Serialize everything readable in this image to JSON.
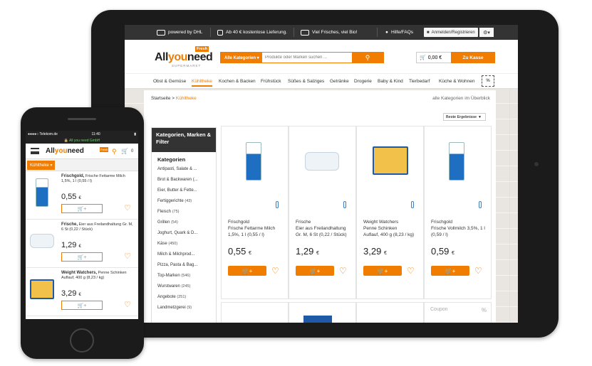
{
  "colors": {
    "accent": "#f07d00",
    "topbar": "#333333"
  },
  "tablet": {
    "topbar": {
      "dhl": "powered by DHL",
      "delivery": "Ab 40 € kostenlose Lieferung.",
      "bio": "Viel Frisches, viel Bio!",
      "help": "Hilfe/FAQs",
      "login": "Anmelden/Registrieren"
    },
    "logo": {
      "part1": "All",
      "part2": "you",
      "part3": "need",
      "fresh": "Fresh",
      "sub": "SUPERMARKT"
    },
    "search": {
      "category": "Alle Kategorien ▾",
      "placeholder": "Produkte oder Marken suchen ..."
    },
    "cart": {
      "total": "0,00 €",
      "checkout": "Zu Kasse"
    },
    "nav": [
      "Obst & Gemüse",
      "Kühltheke",
      "Kochen & Backen",
      "Frühstück",
      "Süßes & Salziges",
      "Getränke",
      "Drogerie",
      "Baby & Kind",
      "Tierbedarf",
      "Küche & Wohnen"
    ],
    "breadcrumb": {
      "home": "Startseite",
      "sep": ">",
      "current": "Kühltheke",
      "all": "alle Kategorien im Überblick"
    },
    "sort": "Beste Ergebnisse",
    "filter": {
      "title": "Kategorien, Marken & Filter",
      "subtitle": "Kategorien",
      "items": [
        {
          "label": "Antipasti, Salate & ...",
          "count": ""
        },
        {
          "label": "Brot & Backwaren (...",
          "count": ""
        },
        {
          "label": "Eier, Butter & Fette...",
          "count": ""
        },
        {
          "label": "Fertiggerichte",
          "count": "(43)"
        },
        {
          "label": "Fleisch",
          "count": "(75)"
        },
        {
          "label": "Grillen",
          "count": "(54)"
        },
        {
          "label": "Joghurt, Quark & D...",
          "count": ""
        },
        {
          "label": "Käse",
          "count": "(450)"
        },
        {
          "label": "Milch & Milchprod...",
          "count": ""
        },
        {
          "label": "Pizza, Pasta & Bag...",
          "count": ""
        },
        {
          "label": "Top-Marken",
          "count": "(546)"
        },
        {
          "label": "Wurstwaren",
          "count": "(245)"
        },
        {
          "label": "Angebote",
          "count": "(251)"
        },
        {
          "label": "Landmetzgerei",
          "count": "(9)"
        }
      ]
    },
    "products": [
      {
        "brand": "Frischgold",
        "name": "Frische Fettarme Milch",
        "detail": "1,5%, 1 l (0,55 / l)",
        "price": "0,55",
        "currency": "€",
        "icon": "milk-carton"
      },
      {
        "brand": "Frische",
        "name": "Eier aus Freilandhaltung",
        "detail": "Gr. M, 6 St (0,22 / Stück)",
        "price": "1,29",
        "currency": "€",
        "icon": "egg-carton"
      },
      {
        "brand": "Weight Watchers",
        "name": "Penne Schinken",
        "detail": "Auflauf, 400 g (8,23 / kg)",
        "price": "3,29",
        "currency": "€",
        "icon": "meal-box"
      },
      {
        "brand": "Frischgold",
        "name": "Frische Vollmilch 3,5%, 1 l",
        "detail": "(0,59 / l)",
        "price": "0,59",
        "currency": "€",
        "icon": "milk-carton"
      }
    ],
    "coupon": {
      "label": "Coupon",
      "pct": "%"
    }
  },
  "phone": {
    "status": {
      "carrier": "●●●●○ Telekom.de",
      "time": "11:40",
      "battery": "▮"
    },
    "lock": "🔒 All you need GmbH",
    "logo": {
      "part1": "All",
      "part2": "you",
      "part3": "need",
      "fresh": "Fresh"
    },
    "cart_count": "0",
    "tab": "Kühltheke ▾",
    "items": [
      {
        "brand": "Frischgold,",
        "desc": "Frische Fettarme Milch 1,5%, 1 l (0,55 / l)",
        "price": "0,55",
        "currency": "€"
      },
      {
        "brand": "Frische,",
        "desc": "Eier aus Freilandhaltung Gr. M, 6 St (0,22 / Stück)",
        "price": "1,29",
        "currency": "€"
      },
      {
        "brand": "Weight Watchers,",
        "desc": "Penne Schinken Auflauf, 400 g (8,23 / kg)",
        "price": "3,29",
        "currency": "€"
      }
    ]
  }
}
